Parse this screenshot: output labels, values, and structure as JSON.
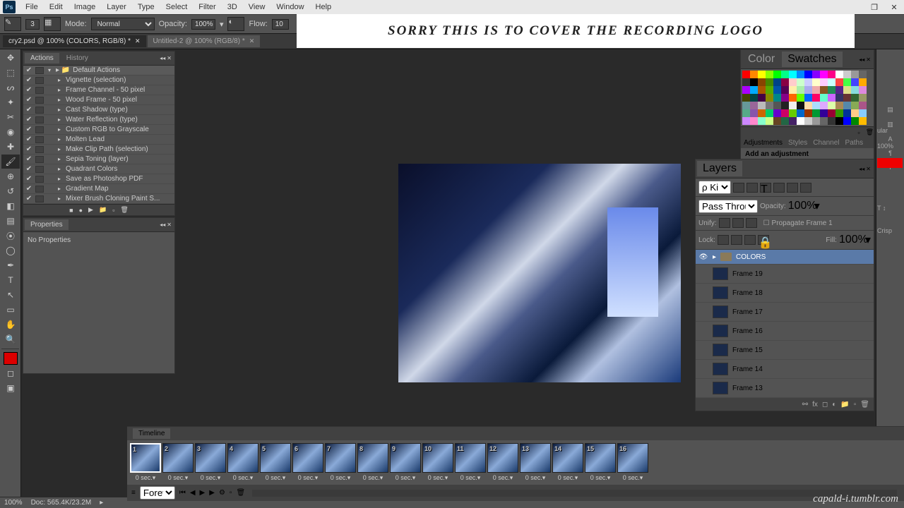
{
  "menu": {
    "items": [
      "File",
      "Edit",
      "Image",
      "Layer",
      "Type",
      "Select",
      "Filter",
      "3D",
      "View",
      "Window",
      "Help"
    ],
    "ps": "Ps"
  },
  "options": {
    "brush_size": "3",
    "mode_label": "Mode:",
    "mode_value": "Normal",
    "opacity_label": "Opacity:",
    "opacity_value": "100%",
    "flow_label": "Flow:",
    "flow_value": "10"
  },
  "tabs": [
    {
      "label": "cry2.psd @ 100% (COLORS, RGB/8) *",
      "active": true
    },
    {
      "label": "Untitled-2 @ 100% (RGB/8) *",
      "active": false
    }
  ],
  "actions": {
    "tabs": [
      "Actions",
      "History"
    ],
    "folder": "Default Actions",
    "items": [
      "Vignette (selection)",
      "Frame Channel - 50 pixel",
      "Wood Frame - 50 pixel",
      "Cast Shadow (type)",
      "Water Reflection (type)",
      "Custom RGB to Grayscale",
      "Molten Lead",
      "Make Clip Path (selection)",
      "Sepia Toning (layer)",
      "Quadrant Colors",
      "Save as Photoshop PDF",
      "Gradient Map",
      "Mixer Brush Cloning Paint S..."
    ]
  },
  "properties": {
    "title": "Properties",
    "empty": "No Properties"
  },
  "color_tabs": [
    "Color",
    "Swatches"
  ],
  "swatch_colors": [
    "#ff0000",
    "#ff8800",
    "#ffff00",
    "#88ff00",
    "#00ff00",
    "#00ff88",
    "#00ffff",
    "#0088ff",
    "#0000ff",
    "#8800ff",
    "#ff00ff",
    "#ff0088",
    "#ffffff",
    "#cccccc",
    "#999999",
    "#666666",
    "#333333",
    "#000000",
    "#884400",
    "#448800",
    "#004488",
    "#880044",
    "#ffcccc",
    "#ccffcc",
    "#ccccff",
    "#ffffcc",
    "#ffccff",
    "#ccffff",
    "#ff4444",
    "#44ff44",
    "#4444ff",
    "#ffaa00",
    "#aa00ff",
    "#00aaff",
    "#aa5500",
    "#55aa00",
    "#0055aa",
    "#550055",
    "#ffeeaa",
    "#aaeeaa",
    "#aaaaee",
    "#eeaaaa",
    "#885522",
    "#228855",
    "#552288",
    "#dddd88",
    "#88dddd",
    "#dd88dd",
    "#444400",
    "#004444",
    "#440044",
    "#888800",
    "#008888",
    "#880088",
    "#ff6600",
    "#66ff00",
    "#0066ff",
    "#ff0066",
    "#66ffcc",
    "#cc66ff",
    "#333366",
    "#663333",
    "#336633",
    "#999966",
    "#669999",
    "#996699",
    "#bbbbbb",
    "#777777",
    "#555555",
    "#222222",
    "#eeeeee",
    "#111111",
    "#ffddaa",
    "#aaddff",
    "#ddaaff",
    "#ddffaa",
    "#aa8855",
    "#5588aa",
    "#88aa55",
    "#aa5588",
    "#55aa88",
    "#8855aa",
    "#cc6600",
    "#00cc66",
    "#6600cc",
    "#cc0066",
    "#66cc00",
    "#0066cc",
    "#993300",
    "#009933",
    "#330099",
    "#990033",
    "#339900",
    "#003399",
    "#ffcc88",
    "#88ccff",
    "#cc88ff",
    "#ff88cc",
    "#88ffcc",
    "#ccff88",
    "#664422",
    "#226644",
    "#442266",
    "#ffffff",
    "#cccccc",
    "#999999",
    "#666666",
    "#333333",
    "#000000",
    "#0000ff",
    "#008800",
    "#ffbb00"
  ],
  "adjustments": {
    "tabs": [
      "Adjustments",
      "Styles",
      "Channel",
      "Paths"
    ],
    "text": "Add an adjustment"
  },
  "layers": {
    "title": "Layers",
    "kind_label": "ρ Kind",
    "blend_mode": "Pass Through",
    "opacity_label": "Opacity:",
    "opacity_value": "100%",
    "unify_label": "Unify:",
    "propagate": "Propagate Frame 1",
    "lock_label": "Lock:",
    "fill_label": "Fill:",
    "fill_value": "100%",
    "items": [
      {
        "name": "COLORS",
        "type": "folder",
        "visible": true,
        "selected": true
      },
      {
        "name": "Frame 19",
        "type": "layer"
      },
      {
        "name": "Frame 18",
        "type": "layer"
      },
      {
        "name": "Frame 17",
        "type": "layer"
      },
      {
        "name": "Frame 16",
        "type": "layer"
      },
      {
        "name": "Frame 15",
        "type": "layer"
      },
      {
        "name": "Frame 14",
        "type": "layer"
      },
      {
        "name": "Frame 13",
        "type": "layer"
      }
    ]
  },
  "timeline": {
    "title": "Timeline",
    "loop": "Forever",
    "frames": [
      1,
      2,
      3,
      4,
      5,
      6,
      7,
      8,
      9,
      10,
      11,
      12,
      13,
      14,
      15,
      16
    ],
    "duration": "0 sec."
  },
  "status": {
    "zoom": "100%",
    "doc": "Doc: 565.4K/23.2M"
  },
  "right_labels": {
    "ular": "ular",
    "pct": "100%",
    "crisp": "Crisp"
  },
  "watermark_top": "SORRY THIS IS TO COVER THE RECORDING LOGO",
  "watermark_br": "capald-i.tumblr.com"
}
